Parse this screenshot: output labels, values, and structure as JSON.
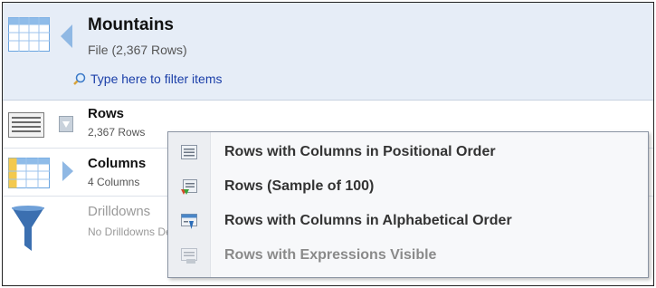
{
  "header": {
    "title": "Mountains",
    "subtitle": "File  (2,367 Rows)",
    "filter_placeholder": "Type here to filter items"
  },
  "rows": [
    {
      "name": "Rows",
      "desc": "2,367 Rows"
    },
    {
      "name": "Columns",
      "desc": "4 Columns"
    },
    {
      "name": "Drilldowns",
      "desc": "No Drilldowns Defined"
    }
  ],
  "menu": {
    "items": [
      {
        "label": "Rows with Columns in Positional Order",
        "icon": "rows-list-icon",
        "enabled": true
      },
      {
        "label": "Rows (Sample of 100)",
        "icon": "rows-sample-icon",
        "enabled": true
      },
      {
        "label": "Rows with Columns in Alphabetical Order",
        "icon": "rows-alpha-icon",
        "enabled": true
      },
      {
        "label": "Rows with Expressions Visible",
        "icon": "rows-expressions-icon",
        "enabled": false
      }
    ]
  },
  "colors": {
    "header_bg": "#e6edf7",
    "link": "#1a3ea8",
    "icon_blue": "#6aa4e0"
  }
}
